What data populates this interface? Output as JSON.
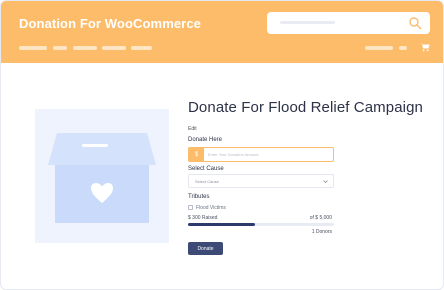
{
  "header": {
    "brand": "Donation For WooCommerce",
    "search_placeholder": "",
    "icons": {
      "search": "search-icon",
      "cart": "cart-icon"
    }
  },
  "product": {
    "title": "Donate For Flood Relief Campaign",
    "edit_label": "Edit",
    "image_icon": "donation-box-icon",
    "donate_label": "Donate Here",
    "currency_symbol": "$",
    "donate_placeholder": "Enter Your Donation Amount",
    "select_cause_label": "Select Cause",
    "select_value": "Select Cause",
    "tributes_label": "Tributes",
    "tribute_option": "Flood Victims",
    "raised_text": "$ 300 Raised",
    "goal_text": "of $ 5,000",
    "progress_fraction": 0.46,
    "donors_text": "1 Donors",
    "button_label": "Donate"
  },
  "colors": {
    "header_bg": "#fdbc6a",
    "button_bg": "#3d4a75",
    "progress_fill": "#2e3a6b",
    "image_bg": "#eef3fd",
    "box_color": "#c9dafb"
  }
}
